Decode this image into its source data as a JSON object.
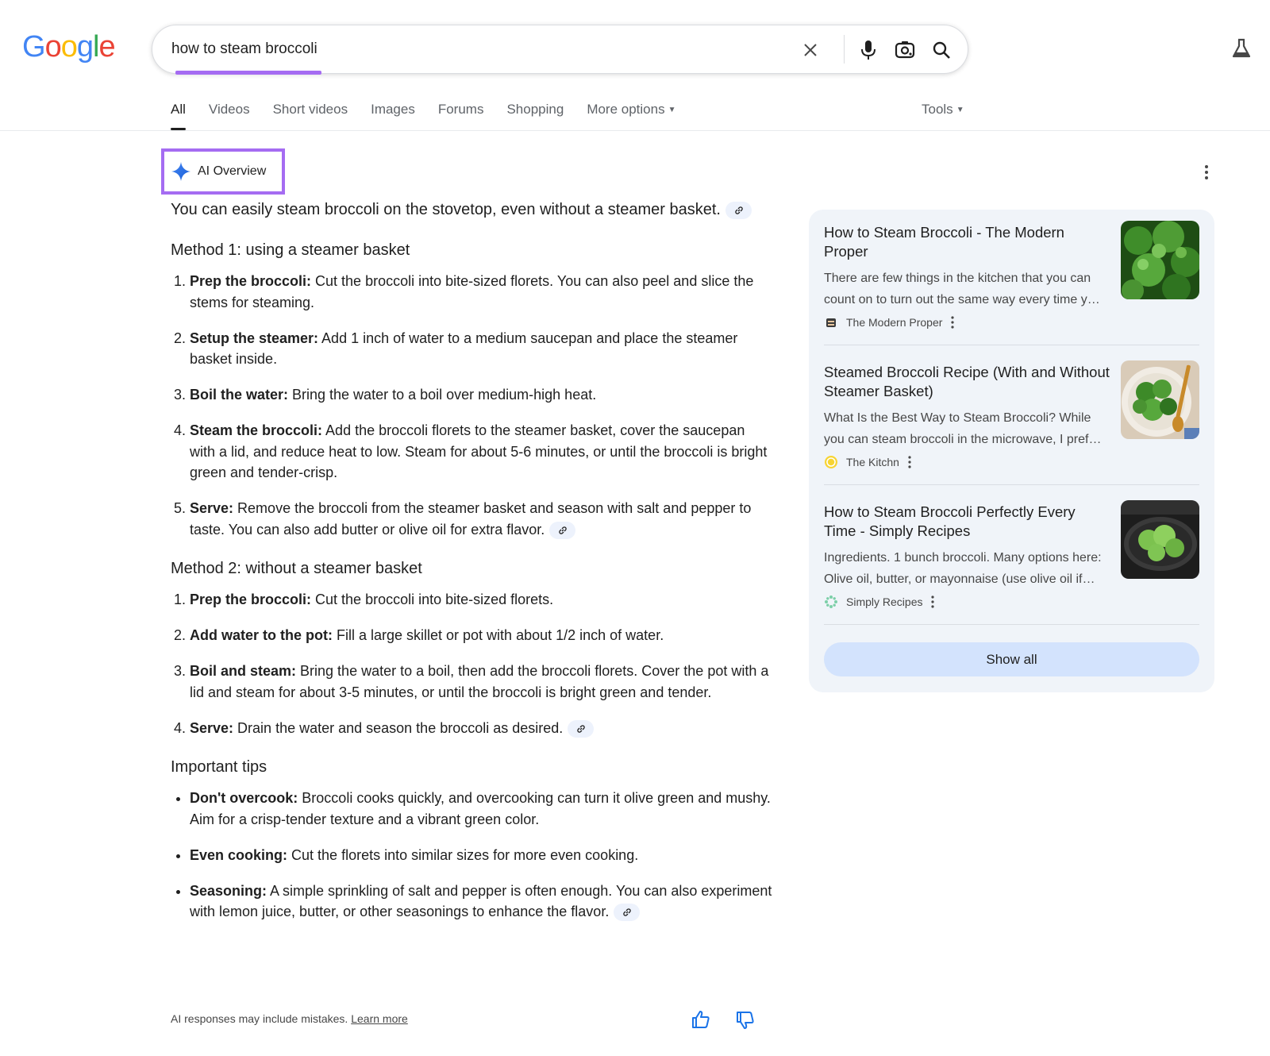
{
  "logo": {
    "letters": [
      "G",
      "o",
      "o",
      "g",
      "l",
      "e"
    ],
    "colors": [
      "#4285F4",
      "#EA4335",
      "#FBBC05",
      "#4285F4",
      "#34A853",
      "#EA4335"
    ]
  },
  "search": {
    "query": "how to steam broccoli",
    "clear_icon": "close-icon",
    "voice_icon": "mic-icon",
    "lens_icon": "lens-icon",
    "search_icon": "search-icon"
  },
  "tabs": [
    {
      "label": "All",
      "active": true
    },
    {
      "label": "Videos"
    },
    {
      "label": "Short videos"
    },
    {
      "label": "Images"
    },
    {
      "label": "Forums"
    },
    {
      "label": "Shopping"
    },
    {
      "label": "More options",
      "caret": true
    }
  ],
  "tools_label": "Tools",
  "ai_overview": {
    "badge_label": "AI Overview",
    "lead": "You can easily steam broccoli on the stovetop, even without a steamer basket.",
    "method1": {
      "heading": "Method 1: using a steamer basket",
      "steps": [
        {
          "bold": "Prep the broccoli:",
          "text": " Cut the broccoli into bite-sized florets. You can also peel and slice the stems for steaming."
        },
        {
          "bold": "Setup the steamer:",
          "text": " Add 1 inch of water to a medium saucepan and place the steamer basket inside."
        },
        {
          "bold": "Boil the water:",
          "text": " Bring the water to a boil over medium-high heat."
        },
        {
          "bold": "Steam the broccoli:",
          "text": " Add the broccoli florets to the steamer basket, cover the saucepan with a lid, and reduce heat to low. Steam for about 5-6 minutes, or until the broccoli is bright green and tender-crisp."
        },
        {
          "bold": "Serve:",
          "text": " Remove the broccoli from the steamer basket and season with salt and pepper to taste. You can also add butter or olive oil for extra flavor."
        }
      ]
    },
    "method2": {
      "heading": "Method 2: without a steamer basket",
      "steps": [
        {
          "bold": "Prep the broccoli:",
          "text": " Cut the broccoli into bite-sized florets."
        },
        {
          "bold": "Add water to the pot:",
          "text": " Fill a large skillet or pot with about 1/2 inch of water."
        },
        {
          "bold": "Boil and steam:",
          "text": " Bring the water to a boil, then add the broccoli florets. Cover the pot with a lid and steam for about 3-5 minutes, or until the broccoli is bright green and tender."
        },
        {
          "bold": "Serve:",
          "text": " Drain the water and season the broccoli as desired."
        }
      ]
    },
    "tips": {
      "heading": "Important tips",
      "items": [
        {
          "bold": "Don't overcook:",
          "text": " Broccoli cooks quickly, and overcooking can turn it olive green and mushy. Aim for a crisp-tender texture and a vibrant green color."
        },
        {
          "bold": "Even cooking:",
          "text": " Cut the florets into similar sizes for more even cooking."
        },
        {
          "bold": "Seasoning:",
          "text": " A simple sprinkling of salt and pepper is often enough. You can also experiment with lemon juice, butter, or other seasonings to enhance the flavor."
        }
      ]
    },
    "footer_note": "AI responses may include mistakes.",
    "learn_more": "Learn more"
  },
  "sources": [
    {
      "title": "How to Steam Broccoli - The Modern Proper",
      "snippet_line1": "There are few things in the kitchen that you can",
      "snippet_line2": "count on to turn out the same way every time y…",
      "source": "The Modern Proper"
    },
    {
      "title": "Steamed Broccoli Recipe (With and Without Steamer Basket)",
      "snippet_line1": "What Is the Best Way to Steam Broccoli? While",
      "snippet_line2": "you can steam broccoli in the microwave, I pref…",
      "source": "The Kitchn"
    },
    {
      "title": "How to Steam Broccoli Perfectly Every Time - Simply Recipes",
      "snippet_line1": "Ingredients. 1 bunch broccoli. Many options here:",
      "snippet_line2": "Olive oil, butter, or mayonnaise (use olive oil if…",
      "source": "Simply Recipes"
    }
  ],
  "show_all": "Show all",
  "colors": {
    "accent_highlight": "#a56cf2",
    "side_panel_bg": "#f0f4f9",
    "show_all_bg": "#d3e3fd"
  }
}
